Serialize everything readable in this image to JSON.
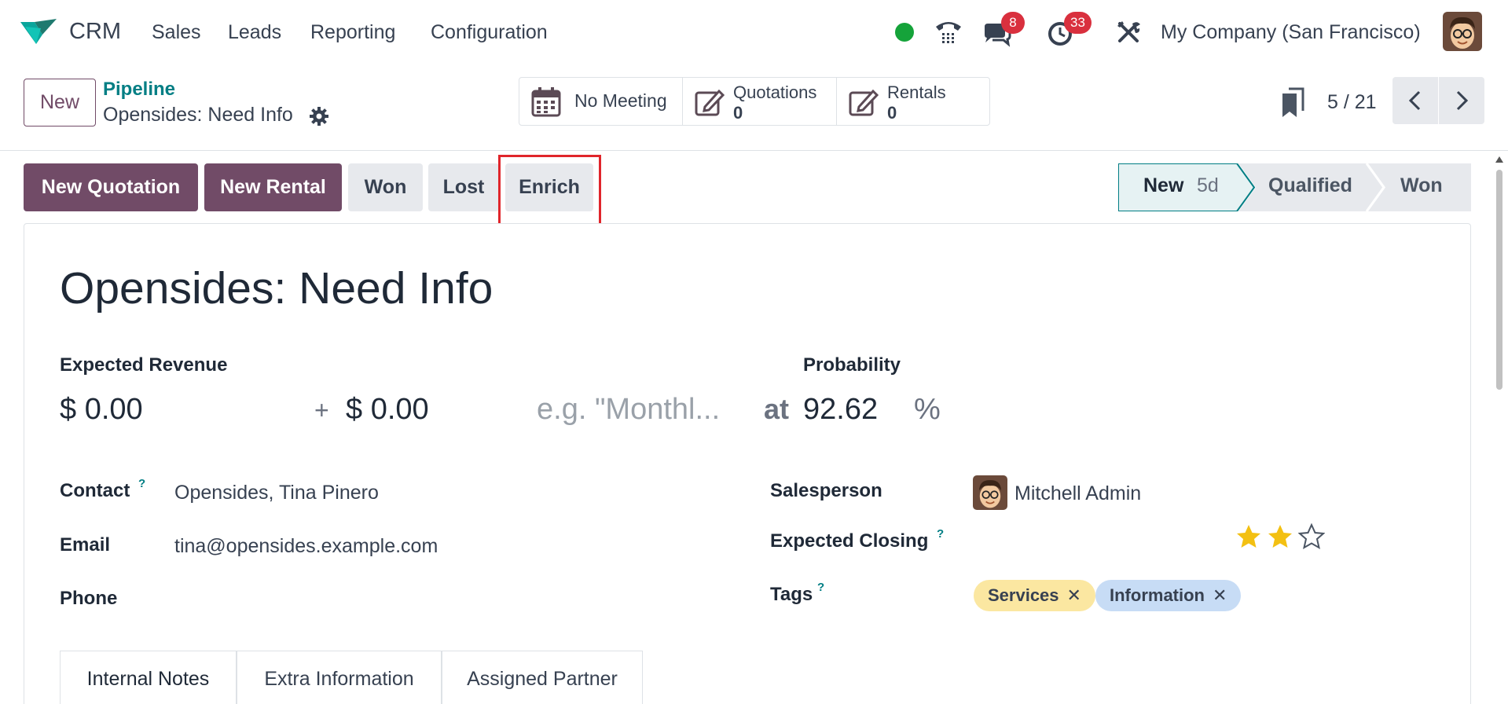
{
  "nav": {
    "app_name": "CRM",
    "menu": [
      "Sales",
      "Leads",
      "Reporting",
      "Configuration"
    ],
    "messages_badge": "8",
    "activities_badge": "33",
    "company": "My Company (San Francisco)"
  },
  "control_panel": {
    "new_label": "New",
    "breadcrumb_parent": "Pipeline",
    "breadcrumb_current": "Opensides: Need Info",
    "smart_buttons": {
      "meeting": "No Meeting",
      "quotations_label": "Quotations",
      "quotations_value": "0",
      "rentals_label": "Rentals",
      "rentals_value": "0"
    },
    "pager": "5 / 21"
  },
  "status_bar": {
    "buttons": [
      "New Quotation",
      "New Rental",
      "Won",
      "Lost",
      "Enrich"
    ],
    "stages": [
      "New",
      "Qualified",
      "Won"
    ],
    "current_stage_duration": "5d"
  },
  "form": {
    "title": "Opensides: Need Info",
    "expected_revenue_label": "Expected Revenue",
    "expected_revenue": "$ 0.00",
    "plus": "+",
    "recurring_revenue": "$ 0.00",
    "recurring_plan_placeholder": "e.g. \"Monthl...",
    "at": "at",
    "probability_label": "Probability",
    "probability": "92.62",
    "percent": "%",
    "contact_label": "Contact",
    "contact": "Opensides, Tina Pinero",
    "email_label": "Email",
    "email": "tina@opensides.example.com",
    "phone_label": "Phone",
    "phone": "",
    "salesperson_label": "Salesperson",
    "salesperson": "Mitchell Admin",
    "expected_closing_label": "Expected Closing",
    "priority_stars": 2,
    "priority_max": 3,
    "tags_label": "Tags",
    "tags": [
      "Services",
      "Information"
    ],
    "help_mark": "?"
  },
  "tabs": [
    "Internal Notes",
    "Extra Information",
    "Assigned Partner"
  ],
  "colors": {
    "primary": "#714b67",
    "link": "#017e84",
    "tag_services": "#fbe7a1",
    "tag_information": "#c7dcf5",
    "badge": "#d9303e",
    "star": "#f3c012",
    "highlight": "#e0252b"
  }
}
